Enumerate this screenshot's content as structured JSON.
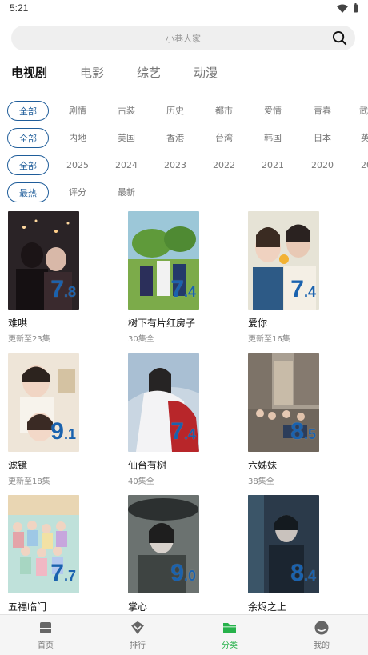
{
  "status": {
    "time": "5:21"
  },
  "search": {
    "placeholder": "小巷人家"
  },
  "tabs": [
    "电视剧",
    "电影",
    "综艺",
    "动漫"
  ],
  "filters": {
    "genre": [
      "全部",
      "剧情",
      "古装",
      "历史",
      "都市",
      "爱情",
      "青春",
      "武"
    ],
    "region": [
      "全部",
      "内地",
      "美国",
      "香港",
      "台湾",
      "韩国",
      "日本",
      "英"
    ],
    "year": [
      "全部",
      "2025",
      "2024",
      "2023",
      "2022",
      "2021",
      "2020",
      "20"
    ],
    "sort": [
      "最热",
      "评分",
      "最新"
    ]
  },
  "items": [
    {
      "title": "难哄",
      "status": "更新至23集",
      "rating_int": "7",
      "rating_dec": ".8"
    },
    {
      "title": "树下有片红房子",
      "status": "30集全",
      "rating_int": "7",
      "rating_dec": ".4"
    },
    {
      "title": "爱你",
      "status": "更新至16集",
      "rating_int": "7",
      "rating_dec": ".4"
    },
    {
      "title": "滤镜",
      "status": "更新至18集",
      "rating_int": "9",
      "rating_dec": ".1"
    },
    {
      "title": "仙台有树",
      "status": "40集全",
      "rating_int": "7",
      "rating_dec": ".4"
    },
    {
      "title": "六姊妹",
      "status": "38集全",
      "rating_int": "8",
      "rating_dec": ".5"
    },
    {
      "title": "五福临门",
      "status": "",
      "rating_int": "7",
      "rating_dec": ".7"
    },
    {
      "title": "掌心",
      "status": "",
      "rating_int": "9",
      "rating_dec": ".0"
    },
    {
      "title": "余烬之上",
      "status": "",
      "rating_int": "8",
      "rating_dec": ".4"
    }
  ],
  "nav": [
    "首页",
    "排行",
    "分类",
    "我的"
  ],
  "colors": {
    "accent": "#1f5d9a",
    "nav_active": "#27b24b",
    "rating": "#1a62ae"
  }
}
